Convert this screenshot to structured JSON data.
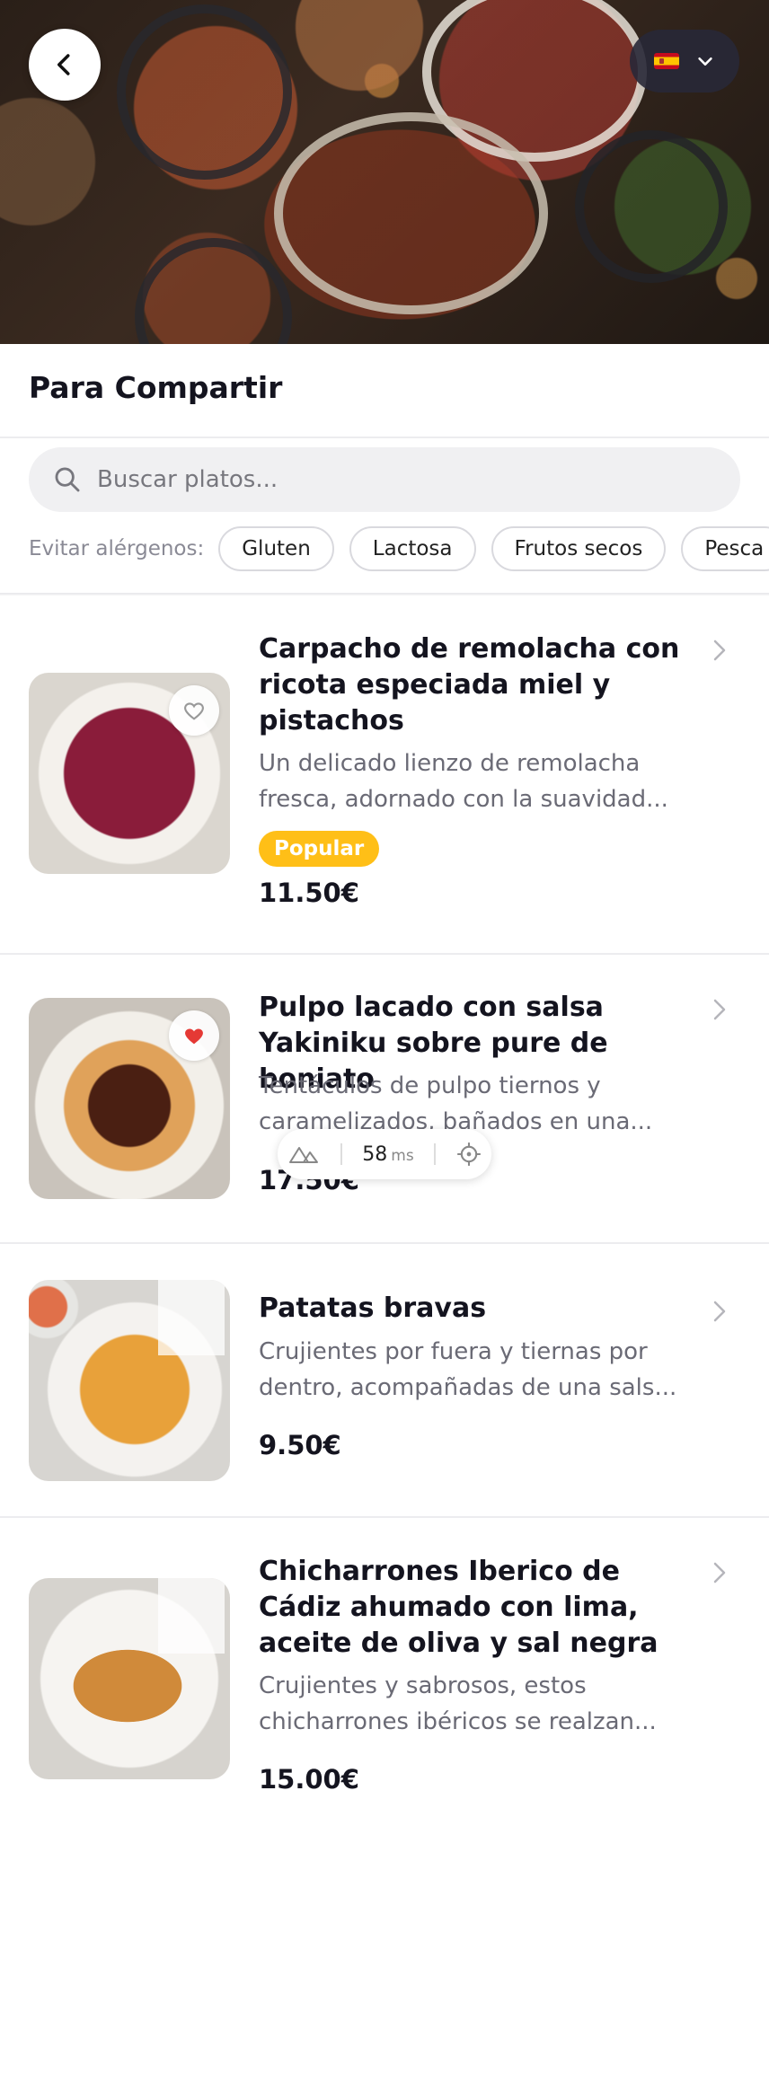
{
  "header": {
    "language_flag": "es-flag-icon"
  },
  "section": {
    "title": "Para Compartir"
  },
  "search": {
    "placeholder": "Buscar platos..."
  },
  "allergens": {
    "label": "Evitar alérgenos:",
    "chips": [
      "Gluten",
      "Lactosa",
      "Frutos secos",
      "Pesca"
    ]
  },
  "dishes": [
    {
      "title": "Carpacho de remolacha con ricota especiada miel y pistachos",
      "description": "Un delicado lienzo de remolacha fresca, adornado con la suavidad...",
      "badge": "Popular",
      "price": "11.50€",
      "favorite": false
    },
    {
      "title": "Pulpo lacado con salsa Yakiniku sobre pure de boniato",
      "description": "Tentáculos de pulpo tiernos y caramelizados, bañados en una...",
      "price": "17.50€",
      "favorite": true
    },
    {
      "title": "Patatas bravas",
      "description": "Crujientes por fuera y tiernas por dentro, acompañadas de una sals...",
      "price": "9.50€",
      "favorite": false
    },
    {
      "title": "Chicharrones Iberico de Cádiz ahumado con lima, aceite de oliva y sal negra",
      "description": "Crujientes y sabrosos, estos chicharrones ibéricos se realzan...",
      "price": "15.00€",
      "favorite": false
    }
  ],
  "perf_widget": {
    "value": "58",
    "unit": "ms"
  },
  "colors": {
    "badge": "#ffbf17",
    "favorite_active": "#e53935",
    "accent_text": "#14141f"
  }
}
